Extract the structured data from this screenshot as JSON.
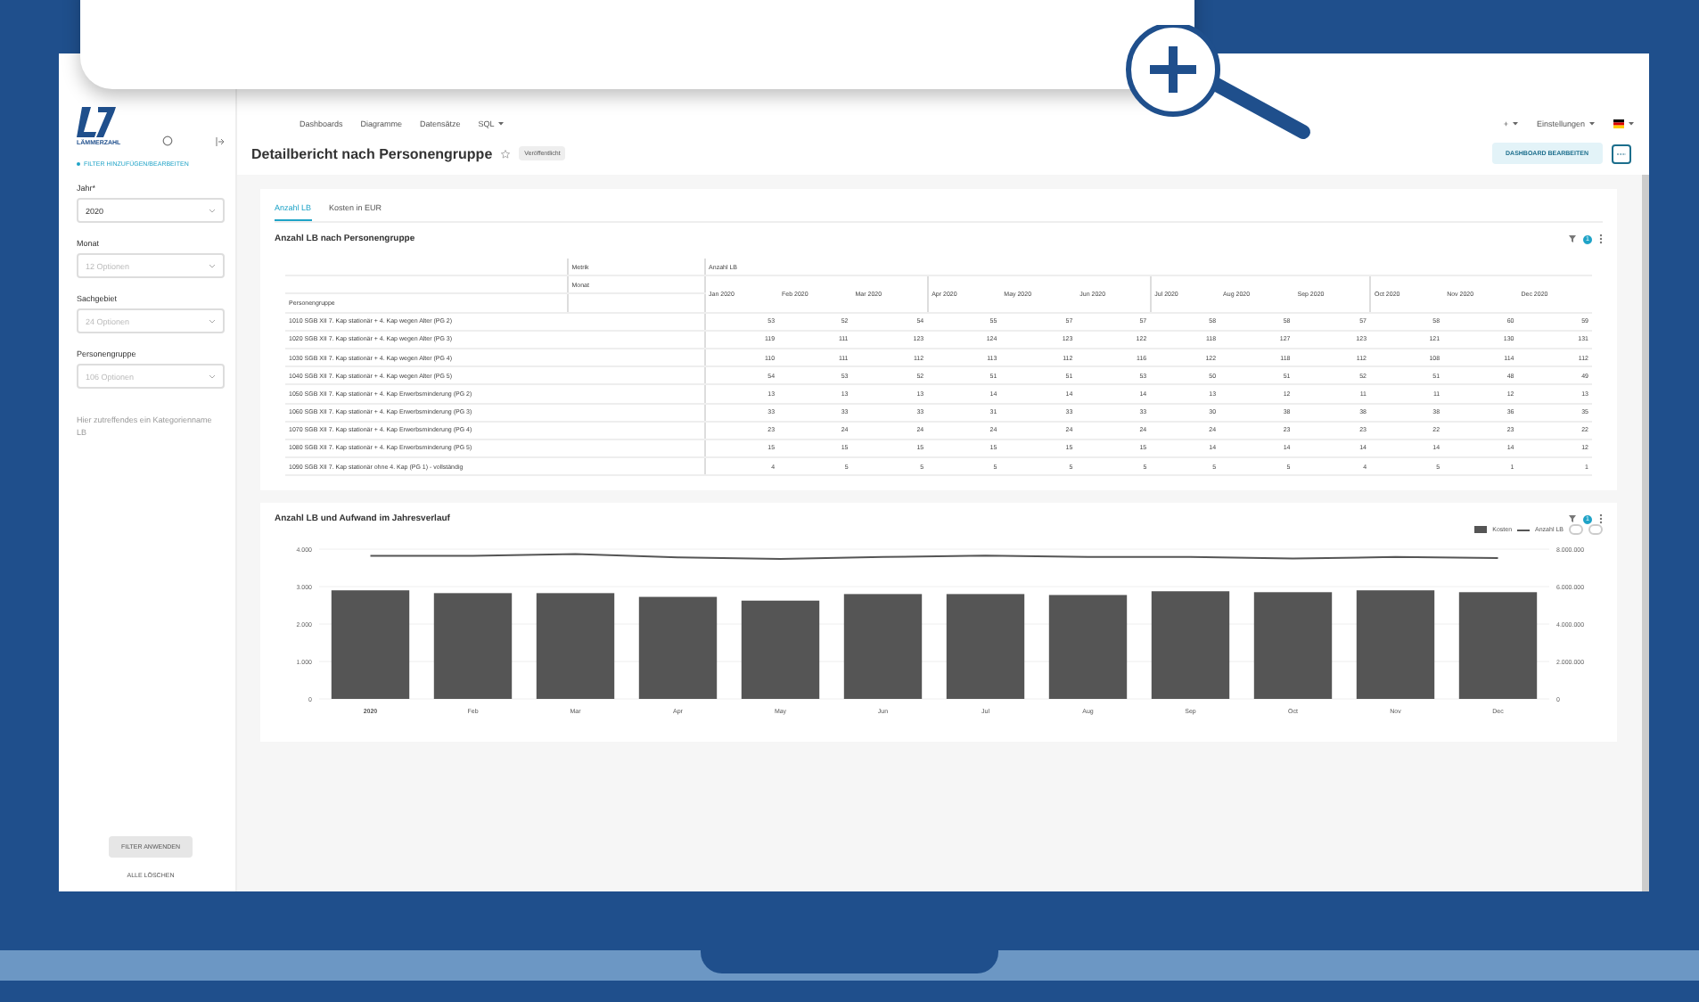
{
  "nav": {
    "items": [
      "Dashboards",
      "Diagramme",
      "Datensätze",
      "SQL"
    ],
    "right": [
      "+",
      "Einstellungen"
    ]
  },
  "logo": {
    "text": "LÄMMERZAHL"
  },
  "sidebar": {
    "filter_link": "FILTER HINZUFÜGEN/BEARBEITEN",
    "filters": [
      {
        "label": "Jahr*",
        "value": "2020",
        "disabled": false
      },
      {
        "label": "Monat",
        "placeholder": "12 Optionen",
        "disabled": false
      },
      {
        "label": "Sachgebiet",
        "placeholder": "24 Optionen",
        "disabled": false
      },
      {
        "label": "Personengruppe",
        "placeholder": "106 Optionen",
        "disabled": false
      },
      {
        "label": "Hier zutreffendes ein Kategorienname LB",
        "disabled": true
      }
    ],
    "buttons": [
      "FILTER ANWENDEN",
      "ALLE LÖSCHEN"
    ]
  },
  "header": {
    "title": "Detailbericht nach Personengruppe",
    "tag": "Veröffentlicht",
    "starred": false,
    "edit_button": "DASHBOARD BEARBEITEN"
  },
  "tabs": [
    {
      "label": "Anzahl LB",
      "selected": true
    },
    {
      "label": "Kosten in EUR",
      "selected": false
    }
  ],
  "table_card": {
    "title": "Anzahl LB nach Personengruppe",
    "filter_count": "1",
    "header": {
      "metric_label": "Metrik",
      "metric_value": "Anzahl LB",
      "month_label": "Monat",
      "row_label": "Personengruppe"
    },
    "columns": [
      "Jan 2020",
      "Feb 2020",
      "Mar 2020",
      "Apr 2020",
      "May 2020",
      "Jun 2020",
      "Jul 2020",
      "Aug 2020",
      "Sep 2020",
      "Oct 2020",
      "Nov 2020",
      "Dec 2020"
    ],
    "rows": [
      {
        "label": "1010 SGB XII 7. Kap stationär + 4. Kap wegen Alter (PG 2)",
        "values": [
          "53",
          "52",
          "54",
          "55",
          "57",
          "57",
          "58",
          "58",
          "57",
          "58",
          "60",
          "59"
        ]
      },
      {
        "label": "1020 SGB XII 7. Kap stationär + 4. Kap wegen Alter (PG 3)",
        "values": [
          "119",
          "111",
          "123",
          "124",
          "123",
          "122",
          "118",
          "127",
          "123",
          "121",
          "130",
          "131"
        ]
      },
      {
        "label": "1030 SGB XII 7. Kap stationär + 4. Kap wegen Alter (PG 4)",
        "values": [
          "110",
          "111",
          "112",
          "113",
          "112",
          "116",
          "122",
          "118",
          "112",
          "108",
          "114",
          "112"
        ]
      },
      {
        "label": "1040 SGB XII 7. Kap stationär + 4. Kap wegen Alter (PG 5)",
        "values": [
          "54",
          "53",
          "52",
          "51",
          "51",
          "53",
          "50",
          "51",
          "52",
          "51",
          "48",
          "49"
        ]
      },
      {
        "label": "1050 SGB XII 7. Kap stationär + 4. Kap Erwerbsminderung (PG 2)",
        "values": [
          "13",
          "13",
          "13",
          "14",
          "14",
          "14",
          "13",
          "12",
          "11",
          "11",
          "12",
          "13"
        ]
      },
      {
        "label": "1060 SGB XII 7. Kap stationär + 4. Kap Erwerbsminderung (PG 3)",
        "values": [
          "33",
          "33",
          "33",
          "31",
          "33",
          "33",
          "30",
          "38",
          "38",
          "38",
          "36",
          "35"
        ]
      },
      {
        "label": "1070 SGB XII 7. Kap stationär + 4. Kap Erwerbsminderung (PG 4)",
        "values": [
          "23",
          "24",
          "24",
          "24",
          "24",
          "24",
          "24",
          "23",
          "23",
          "22",
          "23",
          "22"
        ]
      },
      {
        "label": "1080 SGB XII 7. Kap stationär + 4. Kap Erwerbsminderung (PG 5)",
        "values": [
          "15",
          "15",
          "15",
          "15",
          "15",
          "15",
          "14",
          "14",
          "14",
          "14",
          "14",
          "12"
        ]
      },
      {
        "label": "1090 SGB XII 7. Kap stationär ohne 4. Kap (PG 1) - vollständig",
        "values": [
          "4",
          "5",
          "5",
          "5",
          "5",
          "5",
          "5",
          "5",
          "4",
          "5",
          "1",
          "1"
        ]
      }
    ]
  },
  "chart_card": {
    "title": "Anzahl LB und Aufwand im Jahresverlauf",
    "filter_count": "1",
    "chart_data": {
      "type": "bar",
      "categories": [
        "2020",
        "Feb",
        "Mar",
        "Apr",
        "May",
        "Jun",
        "Jul",
        "Aug",
        "Sep",
        "Oct",
        "Nov",
        "Dec"
      ],
      "series": [
        {
          "name": "Kosten",
          "type": "bar",
          "axis": "y2",
          "color": "#555555",
          "values": [
            5800000,
            5650000,
            5650000,
            5450000,
            5250000,
            5600000,
            5600000,
            5550000,
            5750000,
            5700000,
            5800000,
            5700000
          ]
        },
        {
          "name": "Anzahl LB",
          "type": "line",
          "color": "#555555",
          "values": [
            3820,
            3820,
            3870,
            3780,
            3740,
            3790,
            3830,
            3790,
            3790,
            3750,
            3790,
            3760
          ]
        }
      ],
      "grid": true,
      "ylim": [
        0,
        4000
      ],
      "y2lim": [
        0,
        8000000
      ],
      "yticks": [
        {
          "value": 0,
          "label": "0"
        },
        {
          "value": 1000,
          "label": "1.000"
        },
        {
          "value": 2000,
          "label": "2.000"
        },
        {
          "value": 3000,
          "label": "3.000"
        },
        {
          "value": 4000,
          "label": "4.000"
        }
      ],
      "y2ticks": [
        {
          "value": 0,
          "label": "0"
        },
        {
          "value": 2000000,
          "label": "2.000.000"
        },
        {
          "value": 4000000,
          "label": "4.000.000"
        },
        {
          "value": 6000000,
          "label": "6.000.000"
        },
        {
          "value": 8000000,
          "label": "8.000.000"
        }
      ]
    }
  }
}
